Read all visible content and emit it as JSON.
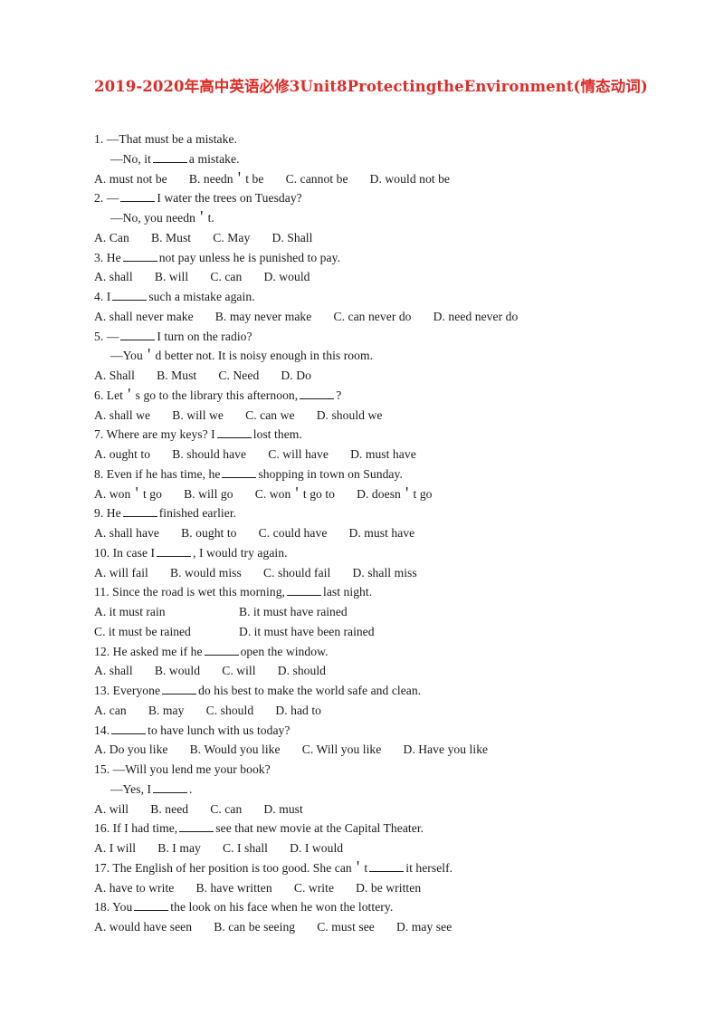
{
  "document": {
    "title": "2019-2020年高中英语必修3Unit8ProtectingtheEnvironment(情态动词)",
    "title_color": "#e02b26",
    "background_color": "#ffffff",
    "text_color": "#1a1a1a"
  },
  "questions": [
    {
      "number": "1.",
      "lines": [
        {
          "text": "1. —That must be a mistake.",
          "indent": false
        },
        {
          "text": "—No, it ____ a mistake.",
          "indent": true,
          "pre_blank": "—No, it ",
          "post_blank": " a mistake."
        }
      ],
      "stem_pre": "1. —That must be a mistake.",
      "options_layout": "inline",
      "options": "A. must not be       B. needn＇t be       C. cannot be       D. would not be"
    },
    {
      "number": "2.",
      "options_layout": "inline",
      "options": "A. Can       B. Must       C. May       D. Shall"
    },
    {
      "number": "3.",
      "options_layout": "inline",
      "options": "A. shall       B. will       C. can       D. would"
    },
    {
      "number": "4.",
      "options_layout": "inline",
      "options": "A. shall never make       B. may never make       C. can never do       D. need never do"
    },
    {
      "number": "5.",
      "options_layout": "inline",
      "options": "A. Shall       B. Must       C. Need       D. Do"
    },
    {
      "number": "6.",
      "options_layout": "inline",
      "options": "A. shall we       B. will we       C. can we       D. should we"
    },
    {
      "number": "7.",
      "options_layout": "inline",
      "options": "A. ought to       B. should have       C. will have       D. must have"
    },
    {
      "number": "8.",
      "options_layout": "inline",
      "options": "A. won＇t go       B. will go       C. won＇t go to       D. doesn＇t go"
    },
    {
      "number": "9.",
      "options_layout": "inline",
      "options": "A. shall have       B. ought to       C. could have       D. must have"
    },
    {
      "number": "10.",
      "options_layout": "inline",
      "options": "A. will fail       B. would miss       C. should fail       D. shall miss"
    },
    {
      "number": "11.",
      "options_layout": "grid",
      "options_grid": [
        [
          "A. it must rain",
          "B. it must have rained"
        ],
        [
          "C. it must be rained",
          "D. it must have been rained"
        ]
      ]
    },
    {
      "number": "12.",
      "options_layout": "inline",
      "options": "A. shall       B. would       C. will       D. should"
    },
    {
      "number": "13.",
      "options_layout": "inline",
      "options": "A. can       B. may       C. should       D. had to"
    },
    {
      "number": "14.",
      "options_layout": "inline",
      "options": "A. Do you like       B. Would you like       C. Will you like       D. Have you like"
    },
    {
      "number": "15.",
      "options_layout": "inline",
      "options": "A. will       B. need       C. can       D. must"
    },
    {
      "number": "16.",
      "options_layout": "inline",
      "options": "A. I will       B. I may       C. I shall       D. I would"
    },
    {
      "number": "17.",
      "options_layout": "inline",
      "options": "A. have to write       B. have written       C. write       D. be written"
    },
    {
      "number": "18.",
      "options_layout": "inline",
      "options": "A. would have seen       B. can be seeing       C. must see       D. may see"
    }
  ],
  "stems": {
    "q1_l1": "1. —That must be a mistake.",
    "q1_l2_a": "—No, it",
    "q1_l2_b": "a mistake.",
    "q2_l1_a": "2. —",
    "q2_l1_b": "I water the trees on Tuesday?",
    "q2_l2": "—No, you needn＇t.",
    "q3_a": "3. He",
    "q3_b": "not pay unless he is punished to pay.",
    "q4_a": "4. I",
    "q4_b": "such a mistake again.",
    "q5_l1_a": "5. —",
    "q5_l1_b": "I turn on the radio?",
    "q5_l2": "—You＇d better not. It is noisy enough in this room.",
    "q6_a": "6. Let＇s go to the library this afternoon,",
    "q6_b": "?",
    "q7_a": "7. Where are my keys? I",
    "q7_b": "lost them.",
    "q8_a": "8. Even if he has time, he",
    "q8_b": "shopping in town on Sunday.",
    "q9_a": "9. He",
    "q9_b": "finished earlier.",
    "q10_a": "10. In case I",
    "q10_b": ", I would try again.",
    "q11_a": "11. Since the road is wet this morning,",
    "q11_b": "last night.",
    "q12_a": "12. He asked me if he",
    "q12_b": "open the window.",
    "q13_a": "13. Everyone",
    "q13_b": "do his best to make the world safe and clean.",
    "q14_a": "14.",
    "q14_b": "to have lunch with us today?",
    "q15_l1": "15. —Will you lend me your book?",
    "q15_l2_a": "—Yes, I",
    "q15_l2_b": ".",
    "q16_a": "16. If I had time,",
    "q16_b": "see that new movie at the Capital Theater.",
    "q17_a": "17. The English of her position is too good. She can＇t",
    "q17_b": "it herself.",
    "q18_a": "18. You",
    "q18_b": "the look on his face when he won the lottery."
  }
}
